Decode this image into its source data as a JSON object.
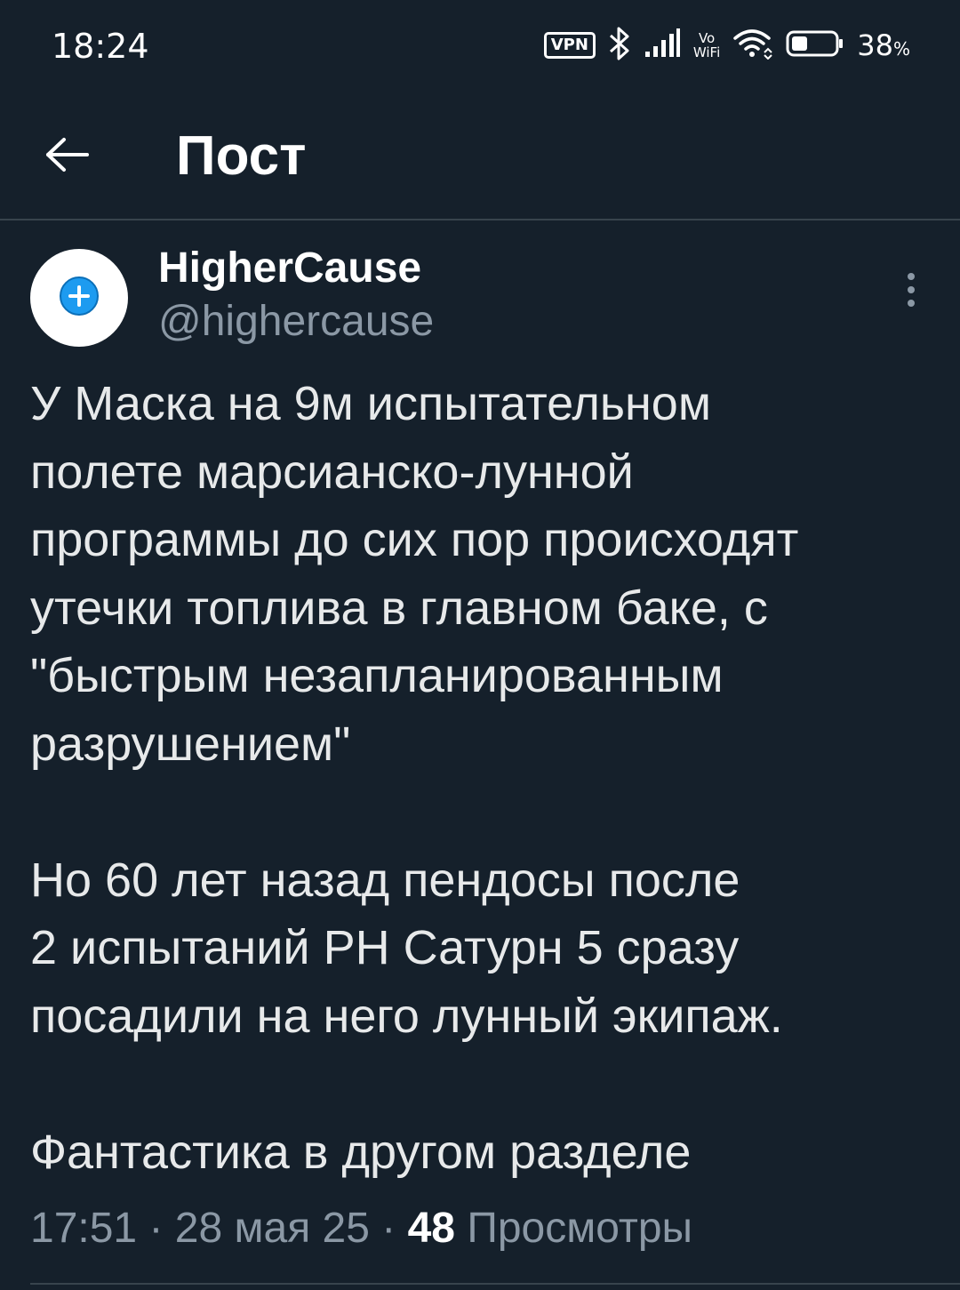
{
  "status_bar": {
    "time": "18:24",
    "vpn_label": "VPN",
    "vowifi_top": "Vo",
    "vowifi_bottom": "WiFi",
    "battery_percent": "38",
    "battery_unit": "%",
    "battery_level": 0.38,
    "icons": [
      "vpn-icon",
      "bluetooth-icon",
      "signal-icon",
      "vowifi-icon",
      "wifi-icon",
      "battery-icon"
    ]
  },
  "header": {
    "back_icon": "arrow-left-icon",
    "title": "Пост"
  },
  "post": {
    "avatar_icon": "plus-circle-icon",
    "display_name": "HigherCause",
    "username": "@highercause",
    "more_icon": "more-vertical-icon",
    "text": "У Маска на 9м испытательном\nполете марсианско-лунной\nпрограммы до сих пор происходят\nутечки топлива в главном баке, с\n\"быстрым незапланированным\nразрушением\"\n\nНо 60 лет назад пендосы после\n2 испытаний РН Сатурн 5 сразу\nпосадили на него лунный экипаж.\n\nФантастика в другом разделе",
    "time": "17:51",
    "separator": "·",
    "date": "28 мая 25",
    "views_count": "48",
    "views_label": "Просмотры"
  },
  "colors": {
    "background": "#15202b",
    "divider": "#38444d",
    "secondary_text": "#8b98a5",
    "primary_text": "#e7e9ea",
    "accent": "#1d9bf0"
  }
}
